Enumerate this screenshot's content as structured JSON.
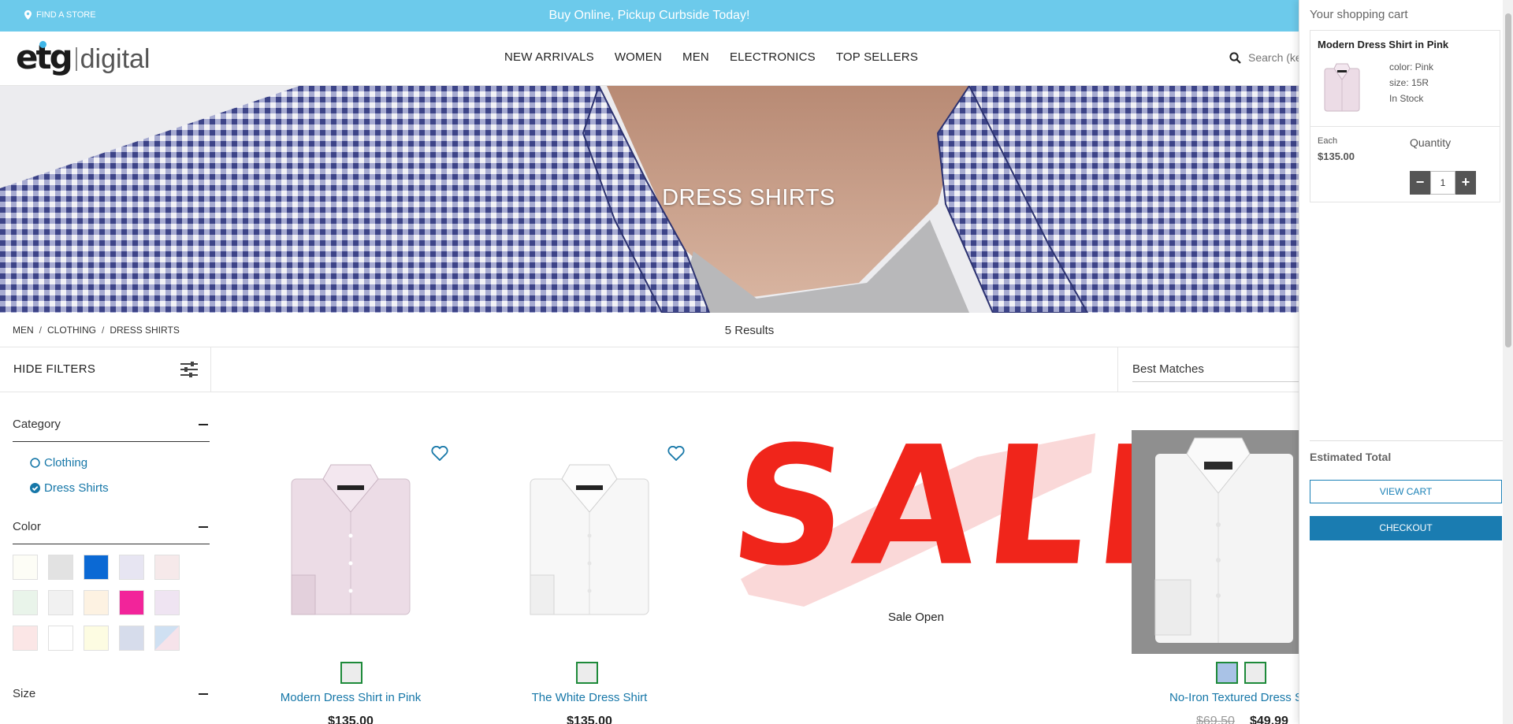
{
  "promo": {
    "find_store": "FIND A STORE",
    "message": "Buy Online, Pickup Curbside Today!"
  },
  "header": {
    "logo_main": "etg",
    "logo_sub": "digital",
    "nav": [
      "NEW ARRIVALS",
      "WOMEN",
      "MEN",
      "ELECTRONICS",
      "TOP SELLERS"
    ],
    "search_placeholder": "Search (ke"
  },
  "hero": {
    "title": "DRESS SHIRTS"
  },
  "breadcrumb": [
    "MEN",
    "CLOTHING",
    "DRESS SHIRTS"
  ],
  "results_count": "5 Results",
  "filters": {
    "hide_label": "HIDE FILTERS",
    "sort_selected": "Best Matches",
    "category_title": "Category",
    "categories": [
      {
        "label": "Clothing",
        "checked": false
      },
      {
        "label": "Dress Shirts",
        "checked": true
      }
    ],
    "color_title": "Color",
    "colors": [
      "#fdfdf6",
      "#e2e2e2",
      "#0b69d4",
      "#e7e5f2",
      "#f6e9ea",
      "#e9f4ea",
      "#f1f1f1",
      "#fdf2e2",
      "#f2249a",
      "#efe4f2",
      "#fbe6e6",
      "#ffffff",
      "#fdfce2",
      "#d6dceb",
      ""
    ],
    "size_title": "Size"
  },
  "products": [
    {
      "name": "Modern Dress Shirt in Pink",
      "price": "$135.00",
      "colors": [
        "#ececec"
      ]
    },
    {
      "name": "The White Dress Shirt",
      "price": "$135.00",
      "colors": [
        "#ececec"
      ]
    },
    {
      "name": "No-Iron Textured Dress S",
      "price_old": "$69.50",
      "price": "$49.99",
      "colors": [
        "#a9c2e6",
        "#ececec"
      ]
    }
  ],
  "sale_tile": {
    "word": "SALE",
    "caption": "Sale Open"
  },
  "cart": {
    "title": "Your shopping cart",
    "item_name": "Modern Dress Shirt in Pink",
    "item_color": "color: Pink",
    "item_size": "size: 15R",
    "item_stock": "In Stock",
    "each_label": "Each",
    "each_price": "$135.00",
    "quantity_label": "Quantity",
    "quantity": "1",
    "minus": "−",
    "plus": "+",
    "estimated_total": "Estimated Total",
    "view_cart": "VIEW CART",
    "checkout": "CHECKOUT"
  }
}
